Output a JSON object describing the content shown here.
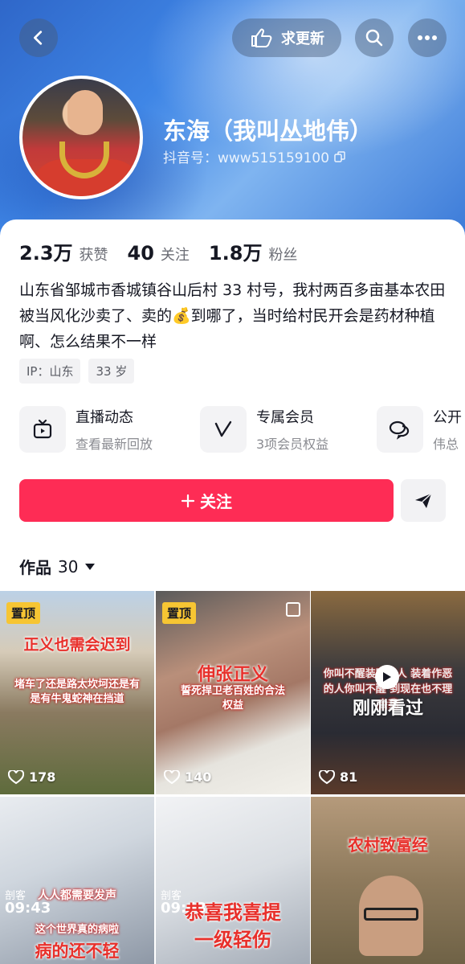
{
  "header": {
    "request_update_label": "求更新"
  },
  "profile": {
    "name": "东海（我叫丛地伟）",
    "douyin_id": "抖音号：www515159100"
  },
  "stats": [
    {
      "num": "2.3万",
      "label": "获赞"
    },
    {
      "num": "40",
      "label": "关注"
    },
    {
      "num": "1.8万",
      "label": "粉丝"
    }
  ],
  "bio": "山东省邹城市香城镇谷山后村 33 村号，我村两百多亩基本农田被当风化沙卖了、卖的💰到哪了，当时给村民开会是药材种植啊、怎么结果不一样",
  "tags": [
    "IP：山东",
    "33 岁"
  ],
  "features": [
    {
      "title": "直播动态",
      "subtitle": "查看最新回放",
      "icon": "tv-icon"
    },
    {
      "title": "专属会员",
      "subtitle": "3项会员权益",
      "icon": "v-icon"
    },
    {
      "title": "公开",
      "subtitle": "伟总",
      "icon": "chat-icon"
    }
  ],
  "actions": {
    "follow_label": "关注"
  },
  "works": {
    "label": "作品",
    "count": "30"
  },
  "videos": [
    {
      "pinned": "置顶",
      "title": "正义也需会迟到",
      "subtitle": "堵车了还是路太坎坷还是有是有牛鬼蛇神在挡道",
      "likes": "178"
    },
    {
      "pinned": "置顶",
      "title": "伸张正义",
      "subtitle": "誓死捍卫老百姓的合法权益",
      "likes": "140"
    },
    {
      "title": "你叫不醒装睡的人 装着作恶的人你叫不醒 到现在也不理会我",
      "badge": "刚刚看过",
      "likes": "81"
    },
    {
      "stamp": "剖客",
      "time": "09:43",
      "title": "人人都需要发声",
      "subtitle": "这个世界真的病啦",
      "caption": "病的还不轻"
    },
    {
      "stamp": "剖客",
      "time": "09:43",
      "title": "恭喜我喜提",
      "caption": "一级轻伤"
    },
    {
      "title": "农村致富经"
    }
  ]
}
